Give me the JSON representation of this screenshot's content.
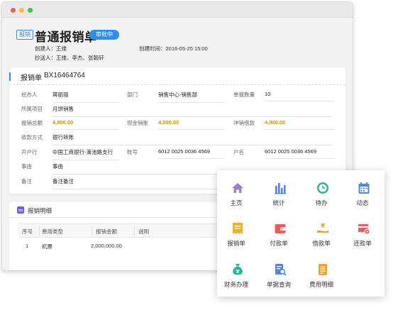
{
  "doc": {
    "tag": "报销",
    "title": "普通报销单",
    "status": "审批中",
    "creator_line": "创建人：王维",
    "created_line": "创建时间：2016-05-25 15:00",
    "cc_line": "抄送人：王维、李杰、张朝轩"
  },
  "summary": {
    "label": "报销单",
    "number": "BX16464764",
    "fields": {
      "handler": {
        "label": "经办人",
        "value": "蒋丽丽"
      },
      "department": {
        "label": "部门",
        "value": "销售中心-销售部"
      },
      "doc_count": {
        "label": "单据数量",
        "value": "10"
      },
      "project": {
        "label": "所属项目",
        "value": "月饼销售"
      },
      "total": {
        "label": "报销总额",
        "value": "4,000.00"
      },
      "cash_offset": {
        "label": "现金销账",
        "value": "4,000.00"
      },
      "loan_offset": {
        "label": "冲销借款",
        "value": "4,000.00"
      },
      "payment_method": {
        "label": "收款方式",
        "value": "银行转账"
      },
      "bank": {
        "label": "开户行",
        "value": "中国工商银行-滴池路支行"
      },
      "account": {
        "label": "账号",
        "value": "6012 0025 0036 4569"
      },
      "account_name": {
        "label": "户名",
        "value": "6012 0025 0036 4569"
      },
      "reason": {
        "label": "事由",
        "value": "事由"
      },
      "remark": {
        "label": "备注",
        "value": "备注备注"
      }
    }
  },
  "details": {
    "title": "报销明细",
    "columns": [
      "序号",
      "费用类型",
      "报销金额",
      "说明"
    ],
    "rows": [
      {
        "index": "1",
        "type": "机票",
        "amount": "2,000,000.00",
        "note": ""
      }
    ]
  },
  "menu": {
    "items": [
      {
        "label": "主页",
        "icon": "home-icon",
        "color": "#9b7fd6"
      },
      {
        "label": "统计",
        "icon": "bar-chart-icon",
        "color": "#4f86e6"
      },
      {
        "label": "待办",
        "icon": "clock-icon",
        "color": "#2bb39b"
      },
      {
        "label": "动态",
        "icon": "calendar-icon",
        "color": "#4f86e6"
      },
      {
        "label": "报销单",
        "icon": "receipt-icon",
        "color": "#f3b21b"
      },
      {
        "label": "付款单",
        "icon": "wallet-icon",
        "color": "#ef5a5a"
      },
      {
        "label": "借款单",
        "icon": "hand-coin-icon",
        "color": "#f3a21b"
      },
      {
        "label": "还款单",
        "icon": "card-return-icon",
        "color": "#ef5a5a"
      },
      {
        "label": "财务办理",
        "icon": "money-bag-icon",
        "color": "#2bb39b"
      },
      {
        "label": "单据查询",
        "icon": "doc-search-icon",
        "color": "#4f86e6"
      },
      {
        "label": "费用明细",
        "icon": "expense-list-icon",
        "color": "#f3a21b"
      }
    ]
  }
}
